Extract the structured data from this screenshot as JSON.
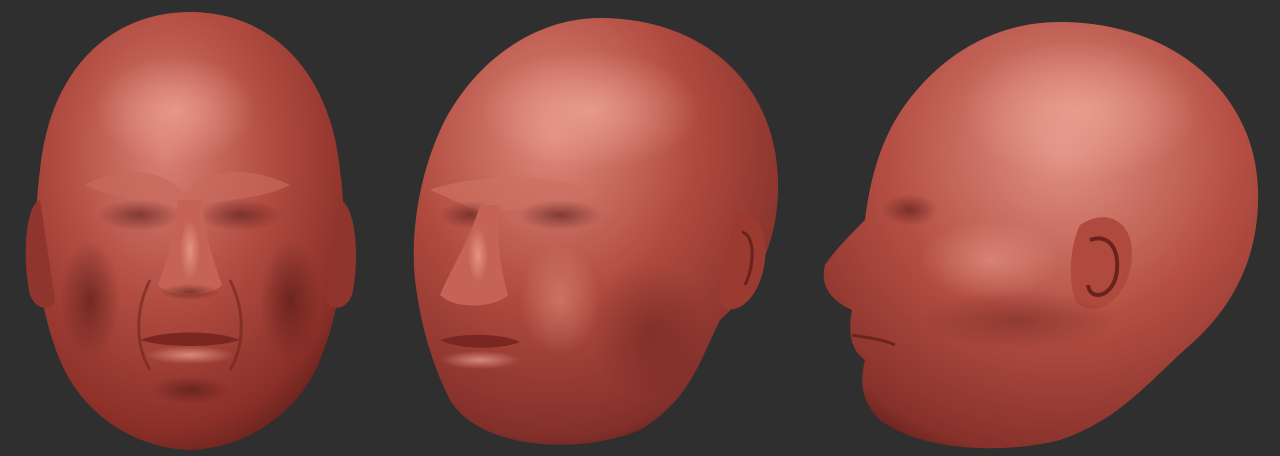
{
  "scene": {
    "background_color": "#2f2f2f",
    "clay_color": "#a8423a",
    "highlight_color": "#d98074",
    "shadow_color": "#5e1e1a",
    "views": [
      {
        "name": "front"
      },
      {
        "name": "three-quarter"
      },
      {
        "name": "profile"
      }
    ]
  }
}
